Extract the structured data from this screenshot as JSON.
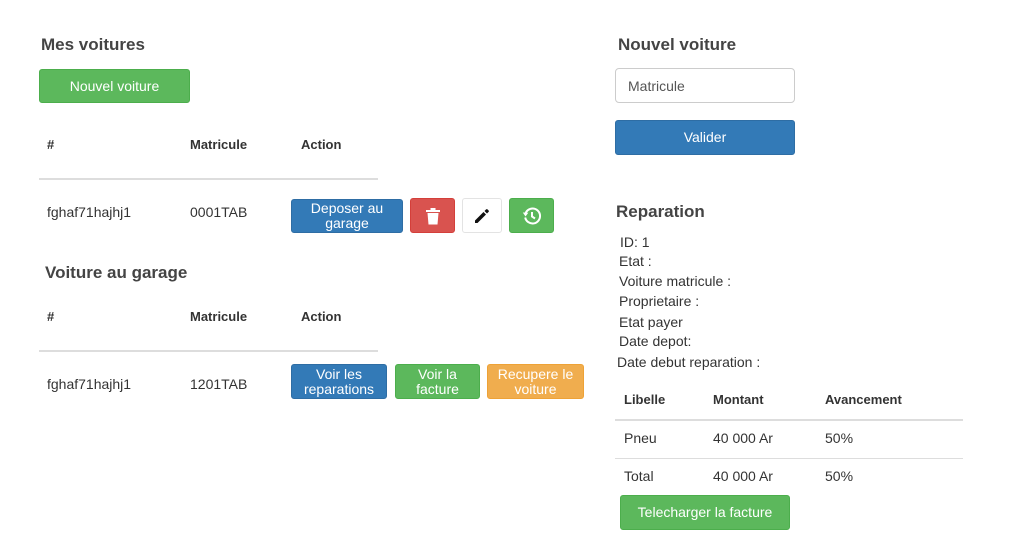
{
  "mes_voitures": {
    "title": "Mes voitures",
    "new_button": "Nouvel voiture",
    "headers": [
      "#",
      "Matricule",
      "Action"
    ],
    "rows": [
      {
        "id": "fghaf71hajhj1",
        "matricule": "0001TAB",
        "deposer_label": "Deposer au garage"
      }
    ]
  },
  "voiture_garage": {
    "title": "Voiture au garage",
    "headers": [
      "#",
      "Matricule",
      "Action"
    ],
    "rows": [
      {
        "id": "fghaf71hajhj1",
        "matricule": "1201TAB",
        "voir_reparations_label": "Voir les reparations",
        "voir_facture_label": "Voir la facture",
        "recuperer_label": "Recupere le voiture"
      }
    ]
  },
  "nouvel_voiture": {
    "title": "Nouvel voiture",
    "matricule_placeholder": "Matricule",
    "valider_label": "Valider"
  },
  "reparation": {
    "title": "Reparation",
    "fields": [
      "ID: 1",
      "Etat :",
      "Voiture matricule :",
      "Proprietaire :",
      "Etat payer",
      "Date depot:",
      "Date debut reparation :"
    ],
    "table": {
      "headers": [
        "Libelle",
        "Montant",
        "Avancement"
      ],
      "rows": [
        [
          "Pneu",
          "40 000 Ar",
          "50%"
        ],
        [
          "Total",
          "40 000 Ar",
          "50%"
        ]
      ]
    },
    "download_label": "Telecharger la facture"
  },
  "colors": {
    "green": "#5cb85c",
    "blue": "#337ab7",
    "red": "#d9534f",
    "orange": "#f0ad4e"
  },
  "icons": [
    "trash-icon",
    "pencil-icon",
    "history-icon"
  ]
}
